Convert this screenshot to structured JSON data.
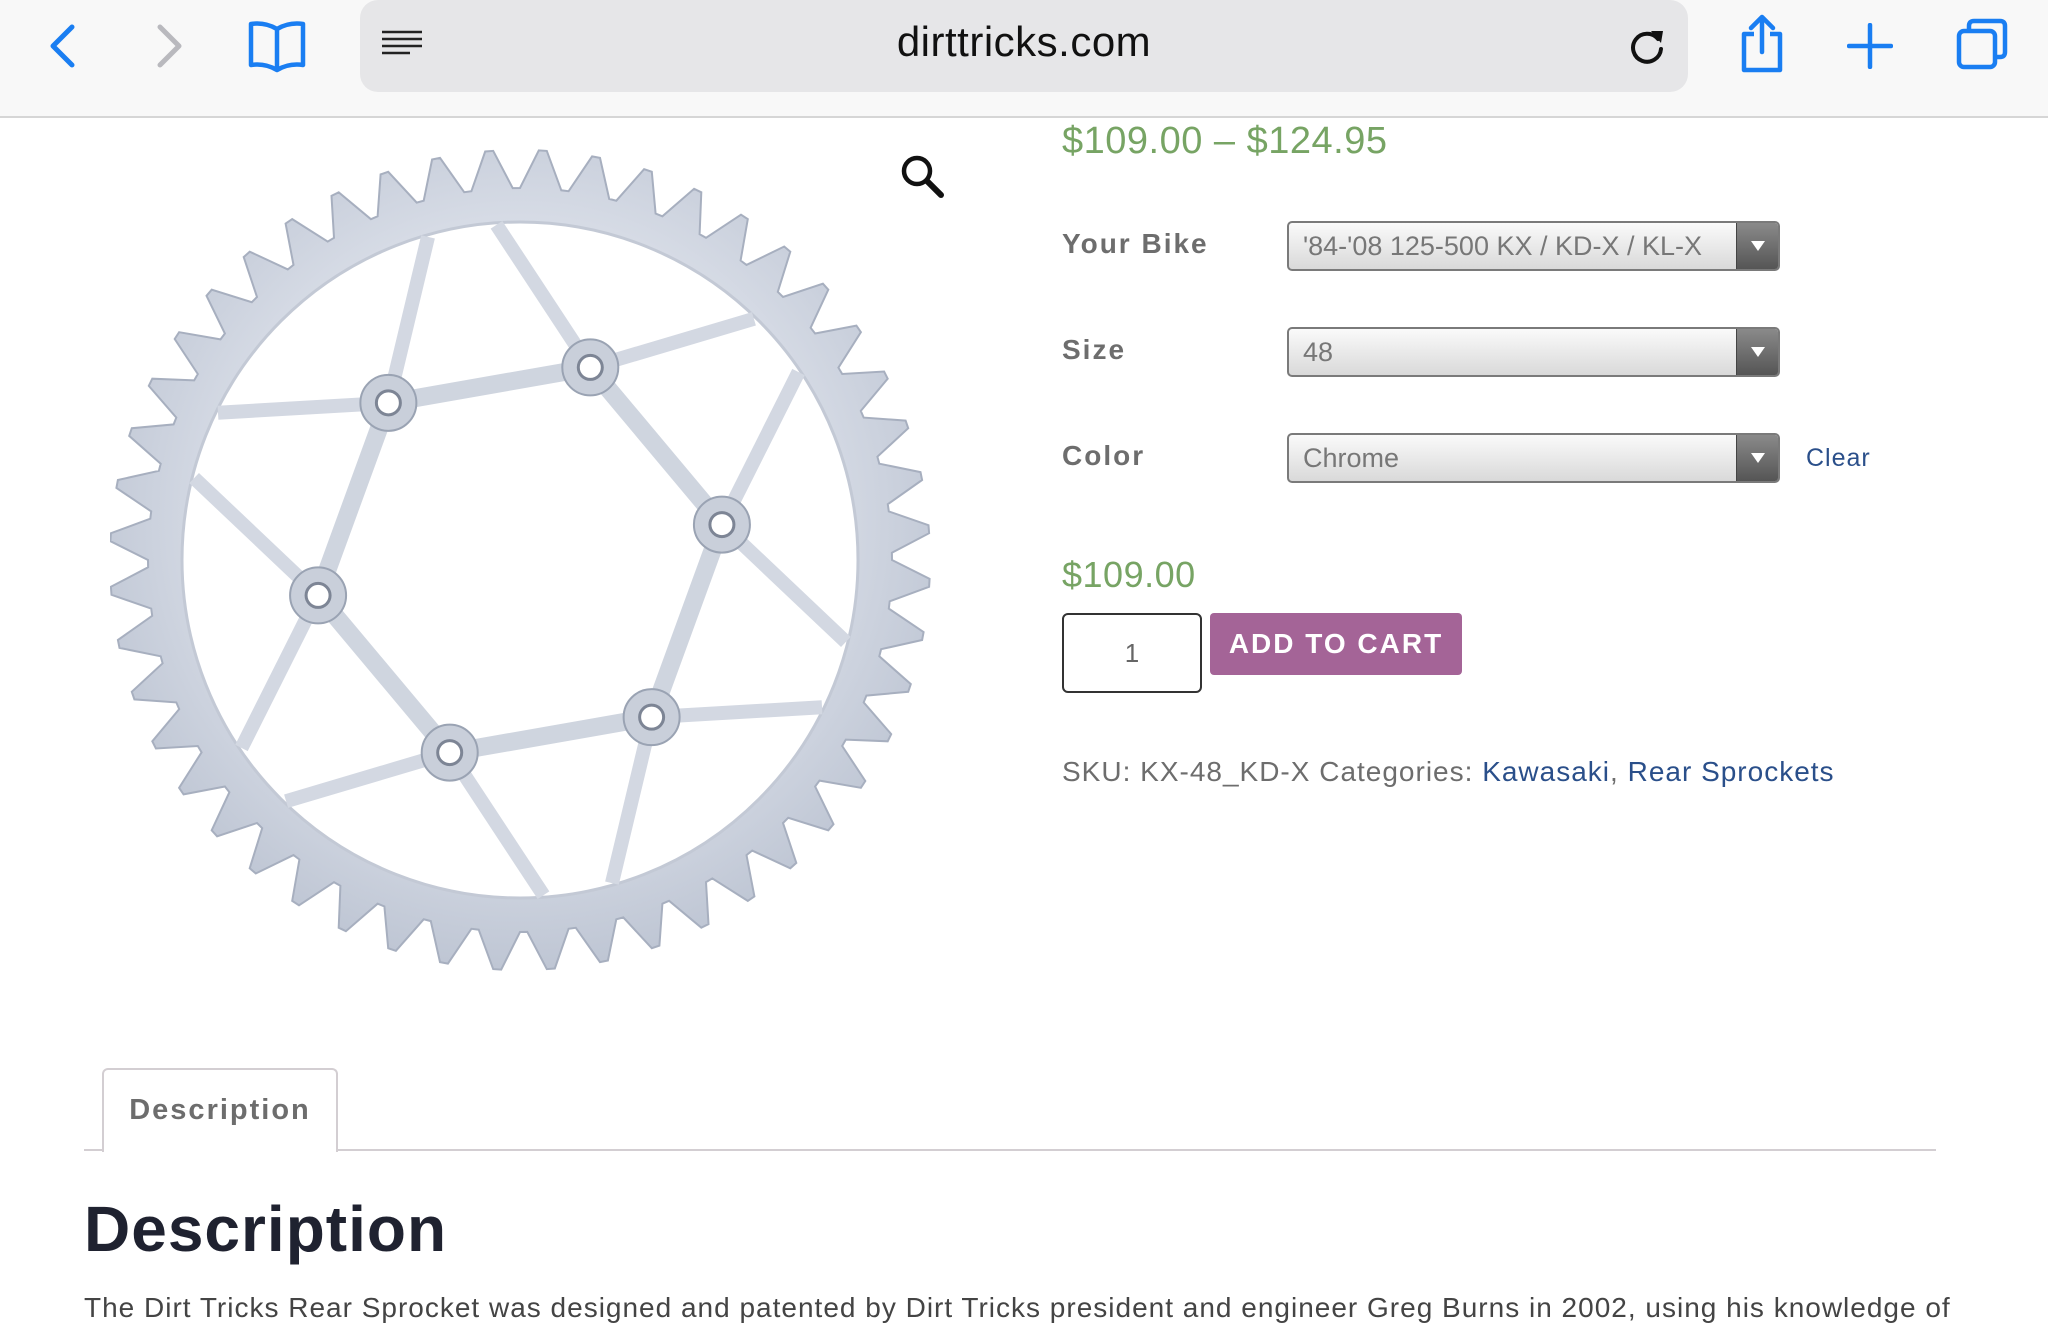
{
  "browser": {
    "url": "dirttricks.com",
    "icons": [
      "back-icon",
      "forward-icon",
      "bookmarks-icon",
      "reader-icon",
      "reload-icon",
      "share-icon",
      "new-tab-icon",
      "tabs-icon"
    ]
  },
  "product": {
    "price_range": "$109.00 – $124.95",
    "variations": [
      {
        "label": "Your Bike",
        "value": "'84-'08 125-500 KX / KD-X / KL-X"
      },
      {
        "label": "Size",
        "value": "48"
      },
      {
        "label": "Color",
        "value": "Chrome"
      }
    ],
    "clear_label": "Clear",
    "price": "$109.00",
    "quantity": "1",
    "add_to_cart_label": "ADD TO CART",
    "sku_label": "SKU:",
    "sku": "KX-48_KD-X",
    "categories_label": "Categories:",
    "categories": [
      "Kawasaki",
      "Rear Sprockets"
    ],
    "separator": ","
  },
  "tabs": [
    {
      "label": "Description"
    }
  ],
  "description": {
    "heading": "Description",
    "text": "The Dirt Tricks Rear Sprocket was designed and patented by Dirt Tricks president and engineer Greg Burns in 2002, using his knowledge of"
  },
  "colors": {
    "price_green": "#77a464",
    "button_purple": "#a46497",
    "link_blue": "#2a4f8a",
    "browser_blue": "#1a7ef2"
  }
}
